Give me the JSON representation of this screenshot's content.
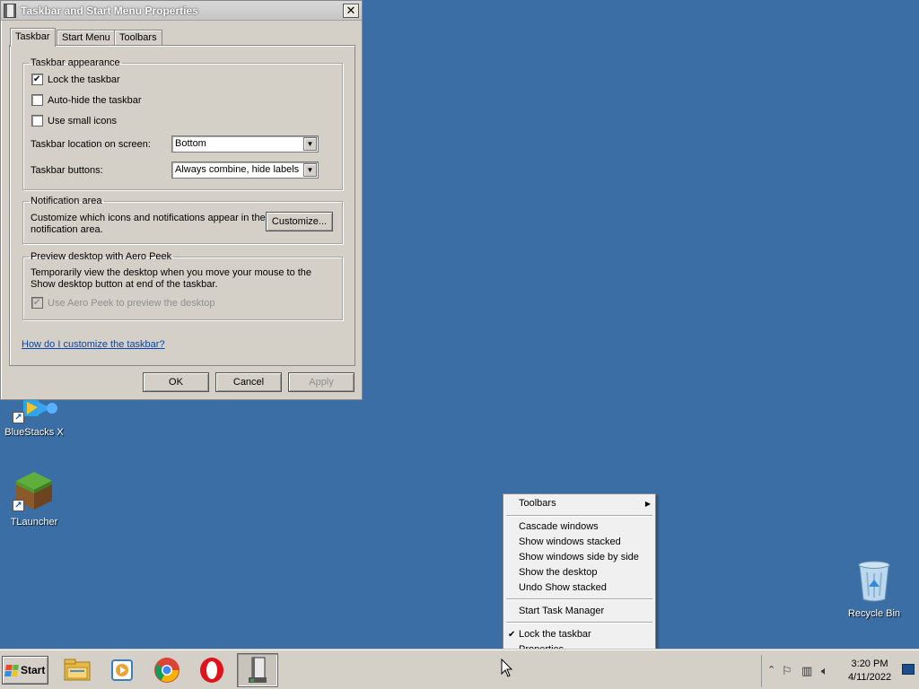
{
  "dialog": {
    "title": "Taskbar and Start Menu Properties",
    "close_glyph": "✕",
    "tabs": [
      "Taskbar",
      "Start Menu",
      "Toolbars"
    ],
    "appearance": {
      "legend": "Taskbar appearance",
      "lock_label": "Lock the taskbar",
      "lock_checked": true,
      "autohide_label": "Auto-hide the taskbar",
      "autohide_checked": false,
      "small_icons_label": "Use small icons",
      "small_icons_checked": false,
      "location_label": "Taskbar location on screen:",
      "location_value": "Bottom",
      "buttons_label": "Taskbar buttons:",
      "buttons_value": "Always combine, hide labels"
    },
    "notification": {
      "legend": "Notification area",
      "text": "Customize which icons and notifications appear in the notification area.",
      "customize_button": "Customize..."
    },
    "aero_peek": {
      "legend": "Preview desktop with Aero Peek",
      "text": "Temporarily view the desktop when you move your mouse to the Show desktop button at end of the taskbar.",
      "checkbox_label": "Use Aero Peek to preview the desktop",
      "checked": true,
      "disabled": true
    },
    "help_link": "How do I customize the taskbar?",
    "ok_label": "OK",
    "cancel_label": "Cancel",
    "apply_label": "Apply"
  },
  "desktop": {
    "background_color": "#3a6ea5",
    "icons": [
      {
        "label": "BlueStacks X",
        "icon": "bluestacks-icon"
      },
      {
        "label": "TLauncher",
        "icon": "minecraft-grass-block-icon"
      },
      {
        "label": "Recycle Bin",
        "icon": "recycle-bin-icon"
      }
    ]
  },
  "context_menu": {
    "toolbars": "Toolbars",
    "cascade": "Cascade windows",
    "stacked": "Show windows stacked",
    "side_by_side": "Show windows side by side",
    "show_desktop": "Show the desktop",
    "undo": "Undo Show stacked",
    "task_manager": "Start Task Manager",
    "lock": "Lock the taskbar",
    "lock_checked": true,
    "properties": "Properties"
  },
  "taskbar": {
    "start_label": "Start",
    "pinned_apps": [
      "file-explorer-icon",
      "media-player-icon",
      "chrome-icon",
      "opera-icon",
      "taskbar-properties-icon"
    ],
    "tray": {
      "icons": [
        "show-hidden-icons-chevron",
        "action-center-flag-icon",
        "network-icon",
        "volume-icon"
      ],
      "time": "3:20 PM",
      "date": "4/11/2022"
    }
  }
}
